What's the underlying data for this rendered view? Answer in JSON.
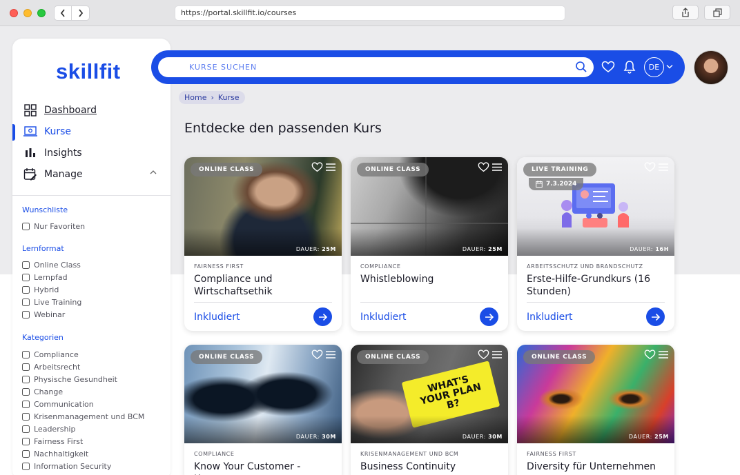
{
  "browser": {
    "url": "https://portal.skillfit.io/courses"
  },
  "brand": {
    "logo_text": "skillfit",
    "accent_color": "#1a4de6"
  },
  "sidebar": {
    "nav": [
      {
        "label": "Dashboard",
        "icon": "grid-icon"
      },
      {
        "label": "Kurse",
        "icon": "laptop-icon",
        "active": true
      },
      {
        "label": "Insights",
        "icon": "bar-chart-icon"
      },
      {
        "label": "Manage",
        "icon": "calendar-edit-icon"
      }
    ],
    "filters": {
      "wishlist": {
        "heading": "Wunschliste",
        "items": [
          "Nur Favoriten"
        ]
      },
      "format": {
        "heading": "Lernformat",
        "items": [
          "Online Class",
          "Lernpfad",
          "Hybrid",
          "Live Training",
          "Webinar"
        ]
      },
      "categories": {
        "heading": "Kategorien",
        "items": [
          "Compliance",
          "Arbeitsrecht",
          "Physische Gesundheit",
          "Change",
          "Communication",
          "Krisenmanagement und BCM",
          "Leadership",
          "Fairness First",
          "Nachhaltigkeit",
          "Information Security"
        ]
      }
    }
  },
  "header": {
    "search_placeholder": "KURSE SUCHEN",
    "language": "DE"
  },
  "breadcrumb": {
    "home": "Home",
    "separator": "›",
    "current": "Kurse"
  },
  "page_title": "Entdecke den passenden Kurs",
  "courses": [
    {
      "badge": "ONLINE CLASS",
      "dauer_label": "DAUER:",
      "dauer": "25M",
      "category": "FAIRNESS FIRST",
      "title": "Compliance und Wirtschaftsethik",
      "status": "Inkludiert"
    },
    {
      "badge": "ONLINE CLASS",
      "dauer_label": "DAUER:",
      "dauer": "25M",
      "category": "COMPLIANCE",
      "title": "Whistleblowing",
      "status": "Inkludiert"
    },
    {
      "badge": "LIVE TRAINING",
      "date": "7.3.2024",
      "dauer_label": "DAUER:",
      "dauer": "16H",
      "category": "ARBEITSSCHUTZ UND BRANDSCHUTZ",
      "title": "Erste-Hilfe-Grundkurs (16 Stunden)",
      "status": "Inkludiert"
    },
    {
      "badge": "ONLINE CLASS",
      "dauer_label": "DAUER:",
      "dauer": "30M",
      "category": "COMPLIANCE",
      "title": "Know Your Customer - Kennen",
      "status": ""
    },
    {
      "badge": "ONLINE CLASS",
      "dauer_label": "DAUER:",
      "dauer": "30M",
      "category": "KRISENMANAGEMENT UND BCM",
      "title": "Business Continuity",
      "status": "",
      "image_text": "WHAT'S YOUR PLAN B?"
    },
    {
      "badge": "ONLINE CLASS",
      "dauer_label": "DAUER:",
      "dauer": "25M",
      "category": "FAIRNESS FIRST",
      "title": "Diversity für Unternehmen",
      "status": ""
    }
  ]
}
